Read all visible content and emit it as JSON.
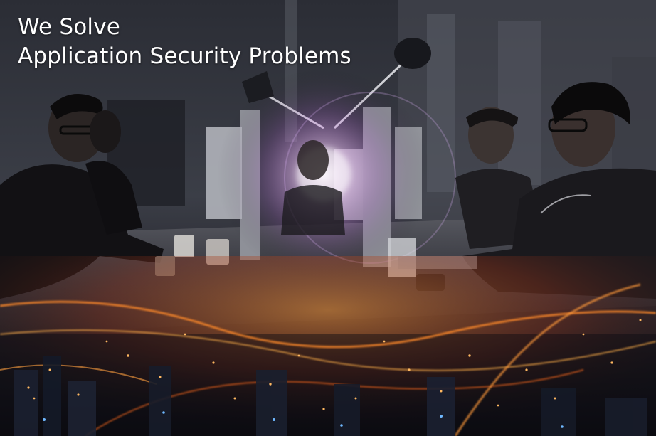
{
  "hero": {
    "headline_line1": "We Solve",
    "headline_line2": "Application Security Problems"
  },
  "colors": {
    "headline_text": "#ffffff",
    "office_tone": "#3a3d45",
    "city_light_orange": "#ff7a1a",
    "city_light_blue": "#4aa3ff",
    "lens_flare": "#ffd6ff"
  },
  "image": {
    "description_hidden": false
  }
}
